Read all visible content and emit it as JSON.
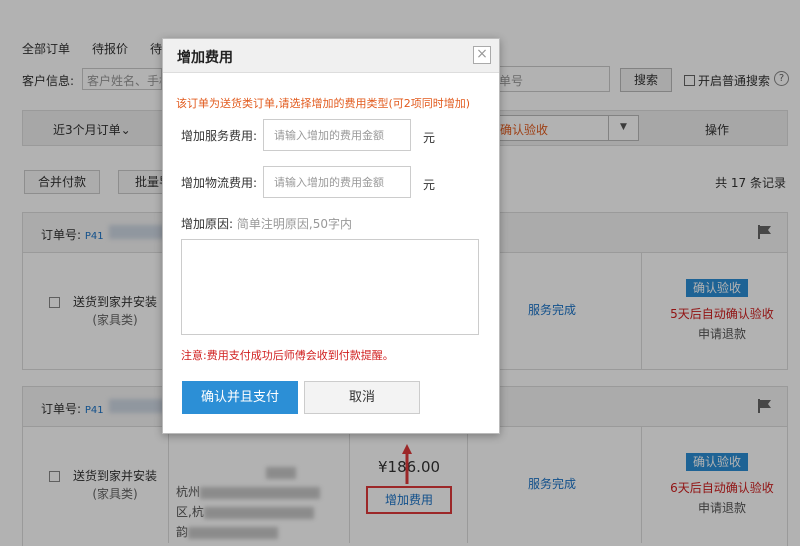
{
  "tabs": [
    "全部订单",
    "待报价",
    "待"
  ],
  "search": {
    "label": "客户信息:",
    "placeholder": "客户姓名、手机",
    "input2_text": "单号",
    "search_button": "搜索",
    "checkbox_label": "开启普通搜索",
    "help_glyph": "?"
  },
  "table_header": {
    "period": "近3个月订单",
    "status_select": "确认验收",
    "operation": "操作"
  },
  "toolbar": {
    "merge_pay": "合并付款",
    "batch": "批量导",
    "total": "共 17 条记录"
  },
  "orders": [
    {
      "order_no_label": "订单号:",
      "order_no_prefix": "P41",
      "service": "送货到家并安装",
      "category": "(家具类)",
      "state": "服务完成",
      "confirm_btn": "确认验收",
      "auto_text": "5天后自动确认验收",
      "refund": "申请退款"
    },
    {
      "order_no_label": "订单号:",
      "order_no_prefix": "P41",
      "service": "送货到家并安装",
      "category": "(家具类)",
      "address_a": "杭州",
      "address_b": "区,杭",
      "address_c": "韵",
      "price": "¥186.00",
      "add_fee": "增加费用",
      "state": "服务完成",
      "confirm_btn": "确认验收",
      "auto_text": "6天后自动确认验收",
      "refund": "申请退款"
    }
  ],
  "dialog": {
    "title": "增加费用",
    "close": "×",
    "notice": "该订单为送货类订单,请选择增加的费用类型(可2项同时增加)",
    "service_fee_label": "增加服务费用:",
    "service_fee_placeholder": "请输入增加的费用金额",
    "logistics_fee_label": "增加物流费用:",
    "logistics_fee_placeholder": "请输入增加的费用金额",
    "unit": "元",
    "reason_label": "增加原因:",
    "reason_hint": "简单注明原因,50字内",
    "warning": "注意:费用支付成功后师傅会收到付款提醒。",
    "confirm_button": "确认并且支付",
    "cancel_button": "取消"
  },
  "colors": {
    "primary_blue": "#2c8fd6",
    "link_blue": "#1a73c8",
    "warning_red": "#d01e1e",
    "notice_orange": "#e25b1e"
  }
}
